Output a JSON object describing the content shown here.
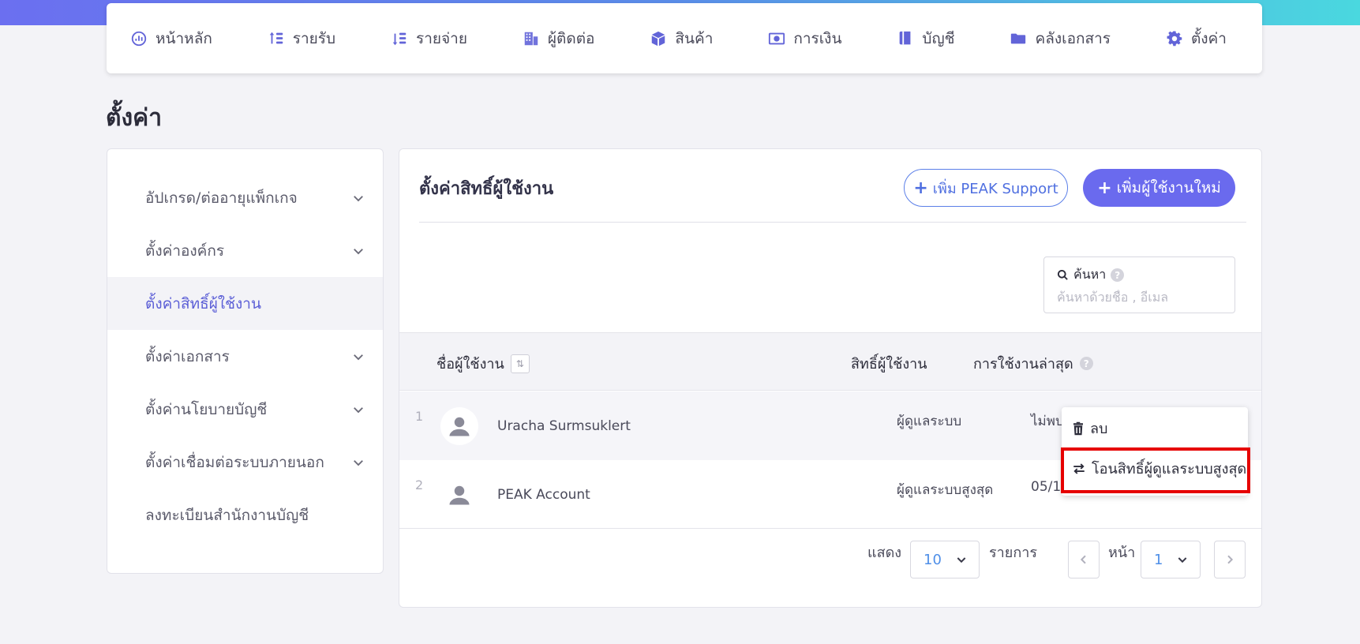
{
  "nav": {
    "items": [
      {
        "label": "หน้าหลัก",
        "icon": "dashboard-icon"
      },
      {
        "label": "รายรับ",
        "icon": "income-icon"
      },
      {
        "label": "รายจ่าย",
        "icon": "expense-icon"
      },
      {
        "label": "ผู้ติดต่อ",
        "icon": "building-icon"
      },
      {
        "label": "สินค้า",
        "icon": "box-icon"
      },
      {
        "label": "การเงิน",
        "icon": "money-icon"
      },
      {
        "label": "บัญชี",
        "icon": "book-icon"
      },
      {
        "label": "คลังเอกสาร",
        "icon": "folder-icon"
      },
      {
        "label": "ตั้งค่า",
        "icon": "gear-icon"
      }
    ]
  },
  "page": {
    "title": "ตั้งค่า"
  },
  "sidebar": {
    "items": [
      {
        "label": "อัปเกรด/ต่ออายุแพ็กเกจ"
      },
      {
        "label": "ตั้งค่าองค์กร"
      },
      {
        "label": "ตั้งค่าสิทธิ์ผู้ใช้งาน"
      },
      {
        "label": "ตั้งค่าเอกสาร"
      },
      {
        "label": "ตั้งค่านโยบายบัญชี"
      },
      {
        "label": "ตั้งค่าเชื่อมต่อระบบภายนอก"
      },
      {
        "label": "ลงทะเบียนสำนักงานบัญชี"
      }
    ],
    "active_index": 2
  },
  "main": {
    "title": "ตั้งค่าสิทธิ์ผู้ใช้งาน",
    "add_support_label": "เพิ่ม PEAK Support",
    "add_user_label": "เพิ่มผู้ใช้งานใหม่",
    "search": {
      "label": "ค้นหา",
      "placeholder": "ค้นหาด้วยชื่อ , อีเมล",
      "value": ""
    },
    "table": {
      "headers": {
        "name": "ชื่อผู้ใช้งาน",
        "role": "สิทธิ์ผู้ใช้งาน",
        "last_used": "การใช้งานล่าสุด"
      },
      "rows": [
        {
          "num": "1",
          "name": "Uracha Surmsuklert",
          "role": "ผู้ดูแลระบบ",
          "last_used": "ไม่พบ"
        },
        {
          "num": "2",
          "name": "PEAK Account",
          "role": "ผู้ดูแลระบบสูงสุด",
          "last_used": "05/1"
        }
      ]
    },
    "context_menu": {
      "delete_label": "ลบ",
      "transfer_label": "โอนสิทธิ์ผู้ดูแลระบบสูงสุด"
    },
    "pagination": {
      "show_label": "แสดง",
      "page_size": "10",
      "items_label": "รายการ",
      "page_label": "หน้า",
      "current_page": "1"
    }
  },
  "colors": {
    "accent": "#6a6aee",
    "active_text": "#5b5ed6",
    "highlight": "#e60000"
  }
}
